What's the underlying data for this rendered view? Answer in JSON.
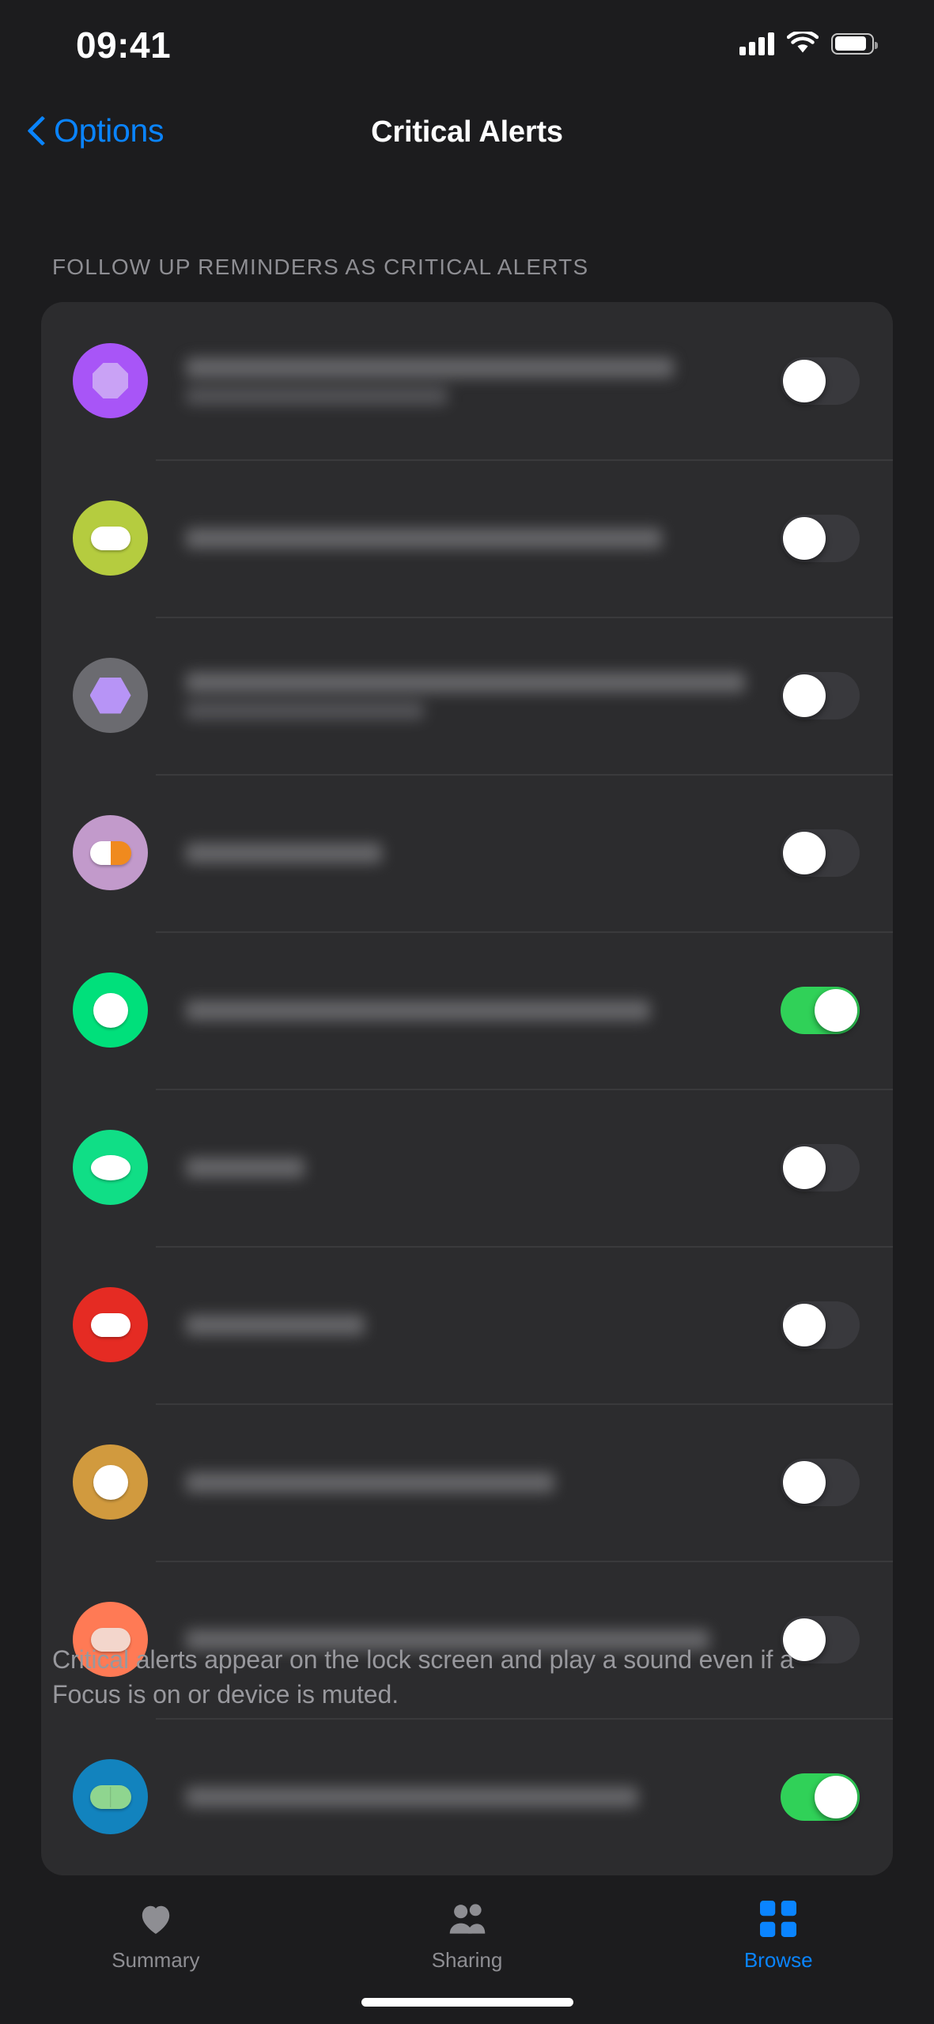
{
  "status_bar": {
    "time": "09:41",
    "icons": [
      "cellular-signal-icon",
      "wifi-icon",
      "battery-icon"
    ]
  },
  "nav": {
    "back_label": "Options",
    "back_icon": "chevron-left-icon",
    "title": "Critical Alerts"
  },
  "section": {
    "header": "FOLLOW UP REMINDERS AS CRITICAL ALERTS"
  },
  "rows": [
    {
      "icon_name": "medication-icon-octagon-purple",
      "bg": "#A855F7",
      "pill": "#C9A2F5",
      "shape": "octagon",
      "toggle": "off",
      "lines": [
        82,
        44
      ]
    },
    {
      "icon_name": "medication-icon-capsule-yellowgreen",
      "bg": "#B5CC3F",
      "pill": "#FFFFFF",
      "shape": "capsule-h",
      "toggle": "off",
      "lines": [
        80,
        0
      ]
    },
    {
      "icon_name": "medication-icon-hexagon-gray",
      "bg": "#6B6B70",
      "pill": "#B794F6",
      "shape": "hexagon",
      "toggle": "off",
      "lines": [
        94,
        40
      ]
    },
    {
      "icon_name": "medication-icon-capsule-twotone",
      "bg": "#C29ACB",
      "pill": "#FFFFFF",
      "pill2": "#F08A1E",
      "shape": "capsule-split",
      "toggle": "off",
      "lines": [
        33,
        0
      ]
    },
    {
      "icon_name": "medication-icon-tablet-green",
      "bg": "#00E07B",
      "pill": "#FFFFFF",
      "shape": "tablet-round",
      "toggle": "on",
      "lines": [
        78,
        0
      ]
    },
    {
      "icon_name": "medication-icon-oval-green",
      "bg": "#10DE86",
      "pill": "#FFFFFF",
      "shape": "oval",
      "toggle": "off",
      "lines": [
        20,
        0
      ]
    },
    {
      "icon_name": "medication-icon-capsule-red",
      "bg": "#E52B23",
      "pill": "#FFFFFF",
      "shape": "capsule-h",
      "toggle": "off",
      "lines": [
        30,
        0
      ]
    },
    {
      "icon_name": "medication-icon-tablet-gold",
      "bg": "#D19A3E",
      "pill": "#FFFFFF",
      "shape": "tablet-round",
      "toggle": "off",
      "lines": [
        62,
        0
      ]
    },
    {
      "icon_name": "medication-icon-capsule-coral",
      "bg": "#FF7A55",
      "pill": "#F3D6CC",
      "shape": "capsule-h",
      "toggle": "off",
      "lines": [
        88,
        0
      ]
    },
    {
      "icon_name": "medication-icon-capsule-blue",
      "bg": "#1283BE",
      "pill": "#8FD58F",
      "shape": "capsule-seam",
      "toggle": "on",
      "lines": [
        76,
        0
      ]
    }
  ],
  "footnote": "Critical alerts appear on the lock screen and play a sound even if a Focus is on or device is muted.",
  "tabs": [
    {
      "label": "Summary",
      "icon": "heart-icon",
      "active": false
    },
    {
      "label": "Sharing",
      "icon": "people-icon",
      "active": false
    },
    {
      "label": "Browse",
      "icon": "grid-icon",
      "active": true
    }
  ],
  "colors": {
    "accent": "#0A84FF",
    "toggle_on": "#30D158",
    "toggle_off": "#39393D",
    "page_bg": "#1C1C1E",
    "card_bg": "#2C2C2E",
    "secondary_text": "#8E8E93"
  }
}
